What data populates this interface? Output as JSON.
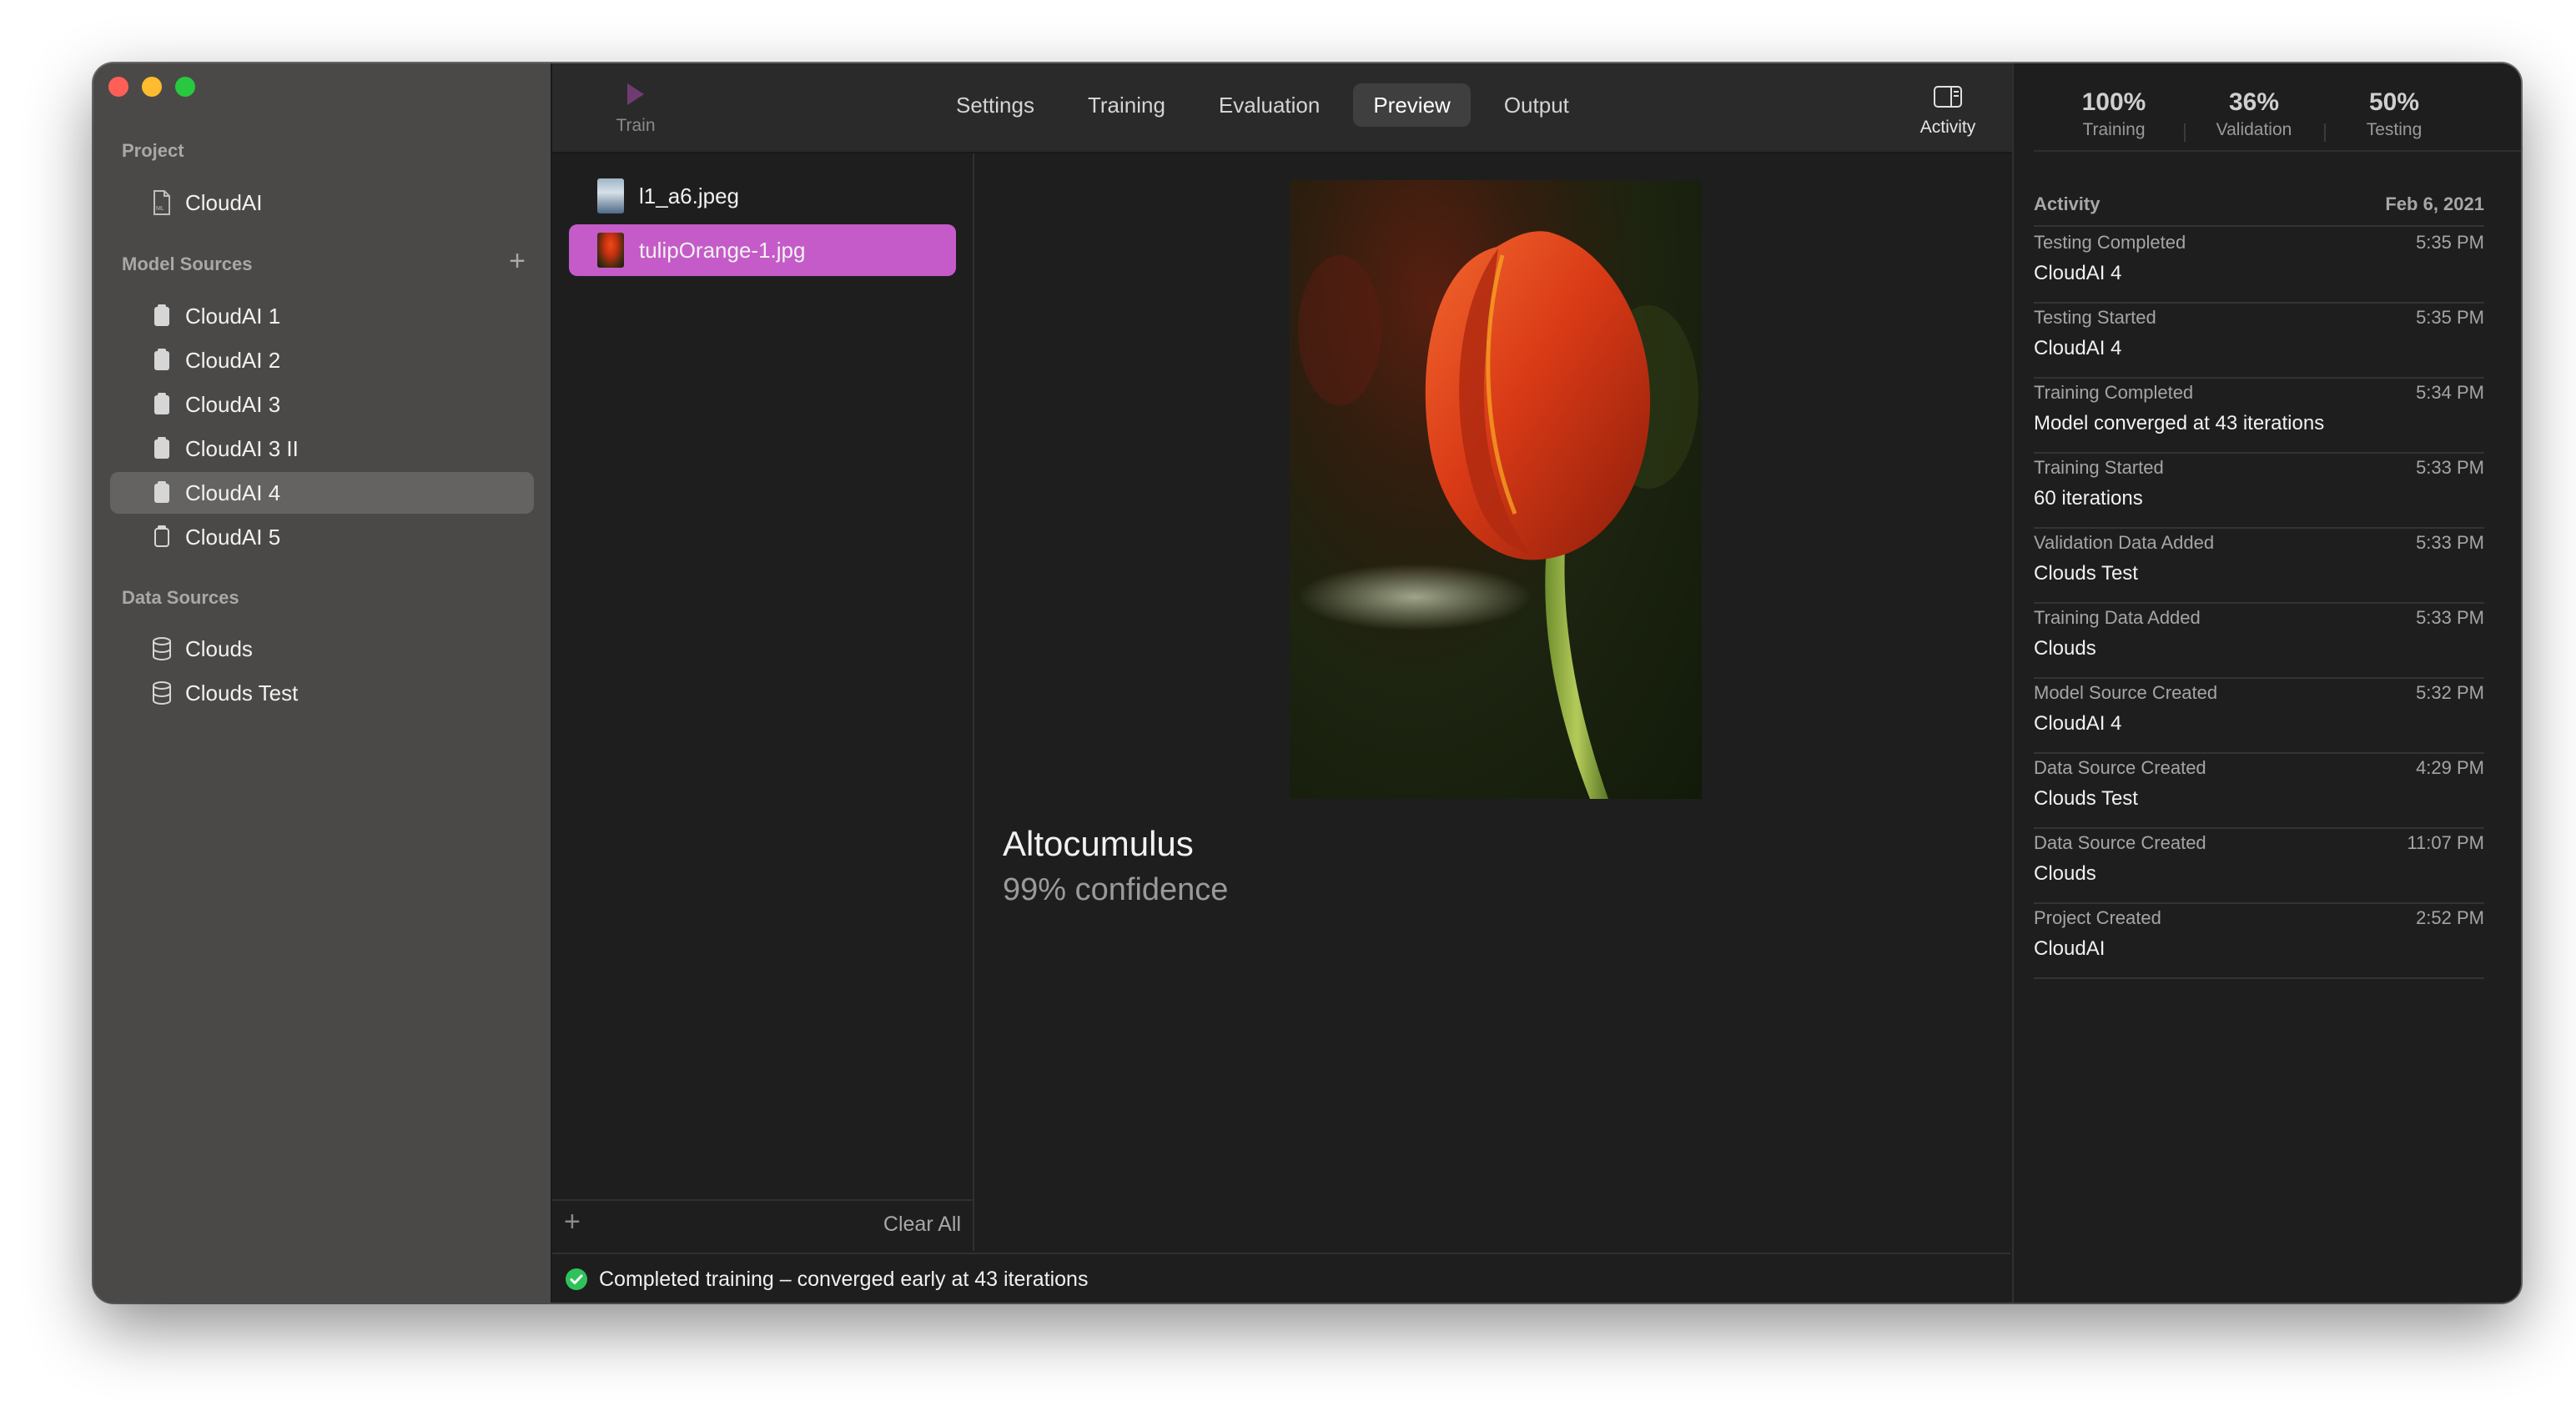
{
  "toolbar": {
    "train_label": "Train",
    "tabs": [
      "Settings",
      "Training",
      "Evaluation",
      "Preview",
      "Output"
    ],
    "active_tab": "Preview",
    "activity_label": "Activity",
    "accent_color": "#c55bc9"
  },
  "sidebar": {
    "project_header": "Project",
    "project_name": "CloudAI",
    "model_sources_header": "Model Sources",
    "model_sources": [
      "CloudAI 1",
      "CloudAI 2",
      "CloudAI 3",
      "CloudAI 3 II",
      "CloudAI 4",
      "CloudAI 5"
    ],
    "selected_model": "CloudAI 4",
    "data_sources_header": "Data Sources",
    "data_sources": [
      "Clouds",
      "Clouds Test"
    ]
  },
  "files": {
    "items": [
      "l1_a6.jpeg",
      "tulipOrange-1.jpg"
    ],
    "selected": "tulipOrange-1.jpg",
    "clear_all": "Clear All"
  },
  "preview": {
    "label": "Altocumulus",
    "confidence": "99% confidence"
  },
  "status": {
    "text": "Completed training – converged early at 43 iterations",
    "icon": "checkmark-circle-icon",
    "color": "#30c25a"
  },
  "stats": [
    {
      "value": "100%",
      "caption": "Training"
    },
    {
      "value": "36%",
      "caption": "Validation"
    },
    {
      "value": "50%",
      "caption": "Testing"
    }
  ],
  "activity": {
    "header": "Activity",
    "date": "Feb 6, 2021",
    "items": [
      {
        "event": "Testing Completed",
        "time": "5:35 PM",
        "detail": "CloudAI 4"
      },
      {
        "event": "Testing Started",
        "time": "5:35 PM",
        "detail": "CloudAI 4"
      },
      {
        "event": "Training Completed",
        "time": "5:34 PM",
        "detail": "Model converged at 43 iterations"
      },
      {
        "event": "Training Started",
        "time": "5:33 PM",
        "detail": "60 iterations"
      },
      {
        "event": "Validation Data Added",
        "time": "5:33 PM",
        "detail": "Clouds Test"
      },
      {
        "event": "Training Data Added",
        "time": "5:33 PM",
        "detail": "Clouds"
      },
      {
        "event": "Model Source Created",
        "time": "5:32 PM",
        "detail": "CloudAI 4"
      },
      {
        "event": "Data Source Created",
        "time": "4:29 PM",
        "detail": "Clouds Test"
      },
      {
        "event": "Data Source Created",
        "time": "11:07 PM",
        "detail": "Clouds"
      },
      {
        "event": "Project Created",
        "time": "2:52 PM",
        "detail": "CloudAI"
      }
    ]
  }
}
